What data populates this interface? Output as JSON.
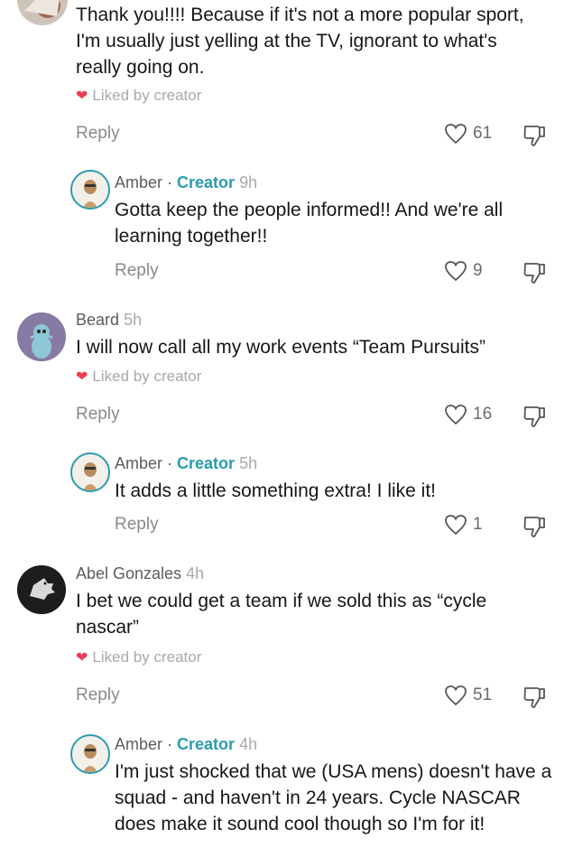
{
  "comments": [
    {
      "text": "Thank you!!!! Because if it's not a more popular sport, I'm usually just yelling at the TV, ignorant to what's really going on.",
      "liked_by": "Liked by creator",
      "reply": "Reply",
      "likes": "61"
    },
    {
      "name": "Amber",
      "sep": " · ",
      "badge": "Creator",
      "time": "9h",
      "text": "Gotta keep the people informed!! And we're all learning together!!",
      "reply": "Reply",
      "likes": "9"
    },
    {
      "name": "Beard",
      "time": "5h",
      "text": "I will now call all my work events “Team Pursuits”",
      "liked_by": "Liked by creator",
      "reply": "Reply",
      "likes": "16"
    },
    {
      "name": "Amber",
      "sep": " · ",
      "badge": "Creator",
      "time": "5h",
      "text": "It adds a little something extra! I like it!",
      "reply": "Reply",
      "likes": "1"
    },
    {
      "name": "Abel Gonzales",
      "time": "4h",
      "text": "I bet we could get a team if we sold this as “cycle nascar”",
      "liked_by": "Liked by creator",
      "reply": "Reply",
      "likes": "51"
    },
    {
      "name": "Amber",
      "sep": " · ",
      "badge": "Creator",
      "time": "4h",
      "text": "I'm just shocked that we (USA mens) doesn't have a squad - and haven't in 24 years. Cycle NASCAR does make it sound cool though so I'm for it!"
    }
  ],
  "colors": {
    "creator_badge": "#2b9bb0",
    "heart": "#ea3d52"
  },
  "icons": {
    "like": "heart-outline-icon",
    "dislike": "thumbs-down-icon",
    "liked": "heart-filled-icon"
  }
}
